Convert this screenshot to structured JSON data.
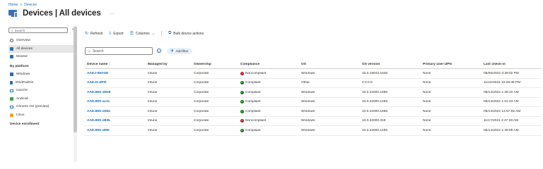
{
  "breadcrumb": {
    "home": "Home",
    "separator": ">",
    "current": "Devices"
  },
  "page_title": "Devices | All devices",
  "title_more": "···",
  "sidebar": {
    "search_placeholder": "Search",
    "collapse_label": "«",
    "items": [
      {
        "label": "Overview",
        "icon": "overview-icon"
      },
      {
        "label": "All devices",
        "icon": "devices-icon",
        "active": true
      },
      {
        "label": "Monitor",
        "icon": "monitor-icon"
      }
    ],
    "platform_header": "By platform",
    "platforms": [
      {
        "label": "Windows",
        "icon": "windows-icon"
      },
      {
        "label": "iOS/iPadOS",
        "icon": "phone-icon"
      },
      {
        "label": "macOS",
        "icon": "mac-icon"
      },
      {
        "label": "Android",
        "icon": "android-icon"
      },
      {
        "label": "Chrome OS (preview)",
        "icon": "chrome-icon"
      },
      {
        "label": "Linux",
        "icon": "linux-icon"
      }
    ],
    "enrollment_header": "Device enrollment"
  },
  "toolbar": {
    "refresh": "Refresh",
    "export": "Export",
    "columns": "Columns",
    "bulk": "Bulk device actions"
  },
  "search": {
    "placeholder": "Search"
  },
  "add_filter": "Add filter",
  "table": {
    "columns": [
      "Device name ↑",
      "Managed by",
      "Ownership",
      "Compliance",
      "OS",
      "OS version",
      "Primary user UPN",
      "Last check-in"
    ],
    "rows": [
      {
        "name": "AADJ-IMAGE",
        "managed": "Intune",
        "ownership": "Corporate",
        "compliance": "Noncompliant",
        "ok": false,
        "os": "Windows",
        "version": "10.0.19043.1645",
        "upn": "None",
        "checkin": "05/08/2022 3:39:02 PM"
      },
      {
        "name": "AADJ3-dP0l",
        "managed": "Intune",
        "ownership": "Corporate",
        "compliance": "Compliant",
        "ok": true,
        "os": "Other",
        "version": "0.0.0.0",
        "upn": "None",
        "checkin": "11/22/2022 10:28:36 PM"
      },
      {
        "name": "AADJMS-2Re8",
        "managed": "Intune",
        "ownership": "Corporate",
        "compliance": "Compliant",
        "ok": true,
        "os": "Windows",
        "version": "10.0.22000.1696",
        "upn": "None",
        "checkin": "05/14/2022 1:39:10 AM"
      },
      {
        "name": "AADJMS-ac11",
        "managed": "Intune",
        "ownership": "Corporate",
        "compliance": "Compliant",
        "ok": true,
        "os": "Windows",
        "version": "10.0.22000.1455",
        "upn": "None",
        "checkin": "05/14/2022 1:01:43 AM"
      },
      {
        "name": "AADJMS-d354",
        "managed": "Intune",
        "ownership": "Corporate",
        "compliance": "Compliant",
        "ok": true,
        "os": "Windows",
        "version": "10.0.22000.1696",
        "upn": "None",
        "checkin": "05/14/2022 12:57:55 AM"
      },
      {
        "name": "AADJMS-d93k",
        "managed": "Intune",
        "ownership": "Corporate",
        "compliance": "Noncompliant",
        "ok": false,
        "os": "Windows",
        "version": "10.0.22000.318",
        "upn": "None",
        "checkin": "11/17/2021 2:37:28 AM"
      },
      {
        "name": "AADJMS-df60",
        "managed": "Intune",
        "ownership": "Corporate",
        "compliance": "Compliant",
        "ok": true,
        "os": "Windows",
        "version": "10.0.22000.1455",
        "upn": "None",
        "checkin": "05/14/2022 1:48:09 AM"
      }
    ]
  },
  "colors": {
    "accent": "#0f6cbd",
    "compliant": "#107c10",
    "noncompliant": "#c50f1f"
  }
}
